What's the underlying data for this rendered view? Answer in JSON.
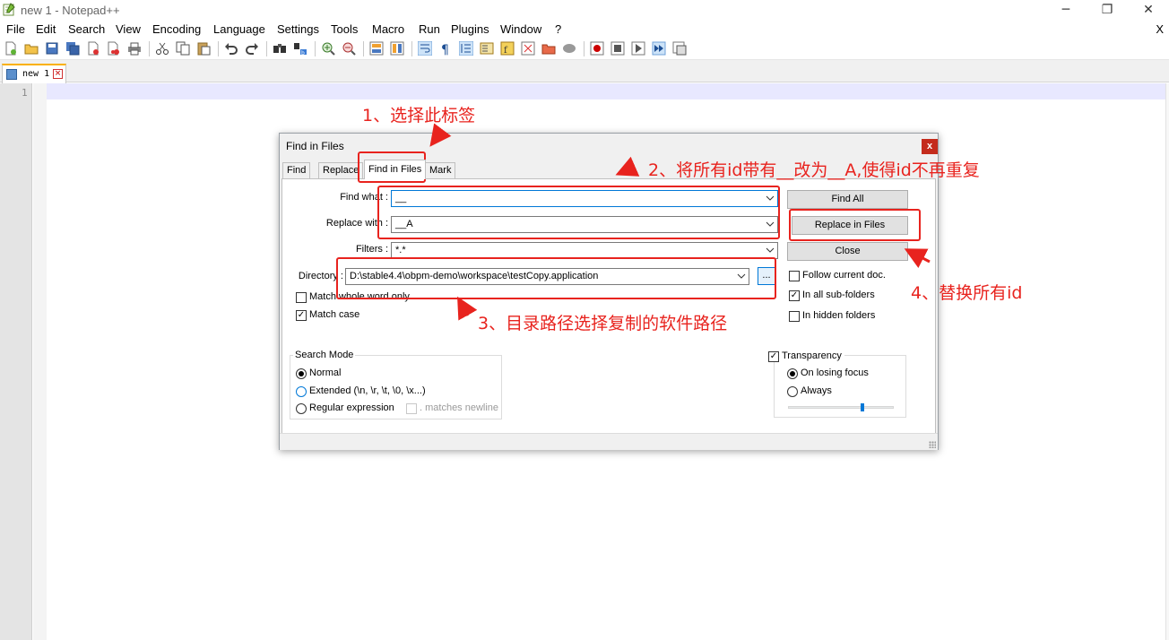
{
  "window": {
    "title": "new 1 - Notepad++",
    "controls": {
      "minimize": "─",
      "maximize": "❐",
      "close": "✕"
    }
  },
  "menu": {
    "items": [
      "File",
      "Edit",
      "Search",
      "View",
      "Encoding",
      "Language",
      "Settings",
      "Tools",
      "Macro",
      "Run",
      "Plugins",
      "Window",
      "?"
    ],
    "close": "X"
  },
  "toolbar": {
    "icons": [
      "new-file-icon",
      "open-file-icon",
      "save-icon",
      "save-all-icon",
      "close-icon",
      "close-all-icon",
      "print-icon",
      "cut-icon",
      "copy-icon",
      "paste-icon",
      "undo-icon",
      "redo-icon",
      "find-icon",
      "replace-icon",
      "zoom-in-icon",
      "zoom-out-icon",
      "sync-vertical-icon",
      "sync-horizontal-icon",
      "word-wrap-icon",
      "show-all-chars-icon",
      "indent-guide-icon",
      "document-map-icon",
      "function-list-icon",
      "folder-workspace-icon",
      "monitoring-icon",
      "record-macro-icon",
      "stop-macro-icon",
      "play-macro-icon",
      "run-macro-multiple-icon",
      "save-macro-icon"
    ]
  },
  "tabs": [
    {
      "label": "new 1"
    }
  ],
  "editor": {
    "line_number": "1"
  },
  "dialog": {
    "title": "Find in Files",
    "close_label": "x",
    "tabs": [
      "Find",
      "Replace",
      "Find in Files",
      "Mark"
    ],
    "active_tab": "Find in Files",
    "labels": {
      "find_what": "Find what :",
      "replace_with": "Replace with :",
      "filters": "Filters :",
      "directory": "Directory :"
    },
    "values": {
      "find_what": "__",
      "replace_with": "__A",
      "filters": "*.*",
      "directory": "D:\\stable4.4\\obpm-demo\\workspace\\testCopy.application"
    },
    "browse_label": "...",
    "buttons": {
      "find_all": "Find All",
      "replace_in_files": "Replace in Files",
      "close": "Close"
    },
    "checkboxes": {
      "match_whole_word": {
        "label": "Match whole word only",
        "checked": false
      },
      "match_case": {
        "label": "Match case",
        "checked": true
      },
      "follow_current_doc": {
        "label": "Follow current doc.",
        "checked": false
      },
      "in_all_sub_folders": {
        "label": "In all sub-folders",
        "checked": true
      },
      "in_hidden_folders": {
        "label": "In hidden folders",
        "checked": false
      }
    },
    "search_mode": {
      "title": "Search Mode",
      "options": [
        "Normal",
        "Extended (\\n, \\r, \\t, \\0, \\x...)",
        "Regular expression"
      ],
      "selected": "Normal",
      "matches_newline": ". matches newline"
    },
    "transparency": {
      "label": "Transparency",
      "checked": true,
      "options": [
        "On losing focus",
        "Always"
      ],
      "selected": "On losing focus"
    }
  },
  "annotations": {
    "step1": "1、选择此标签",
    "step2": "2、将所有id带有__改为__A,使得id不再重复",
    "step3": "3、目录路径选择复制的软件路径",
    "step4": "4、替换所有id"
  },
  "colors": {
    "annotation": "#e8231e",
    "focus": "#0078d7",
    "current_line": "#e8e8ff",
    "close_button": "#c42b1c"
  }
}
